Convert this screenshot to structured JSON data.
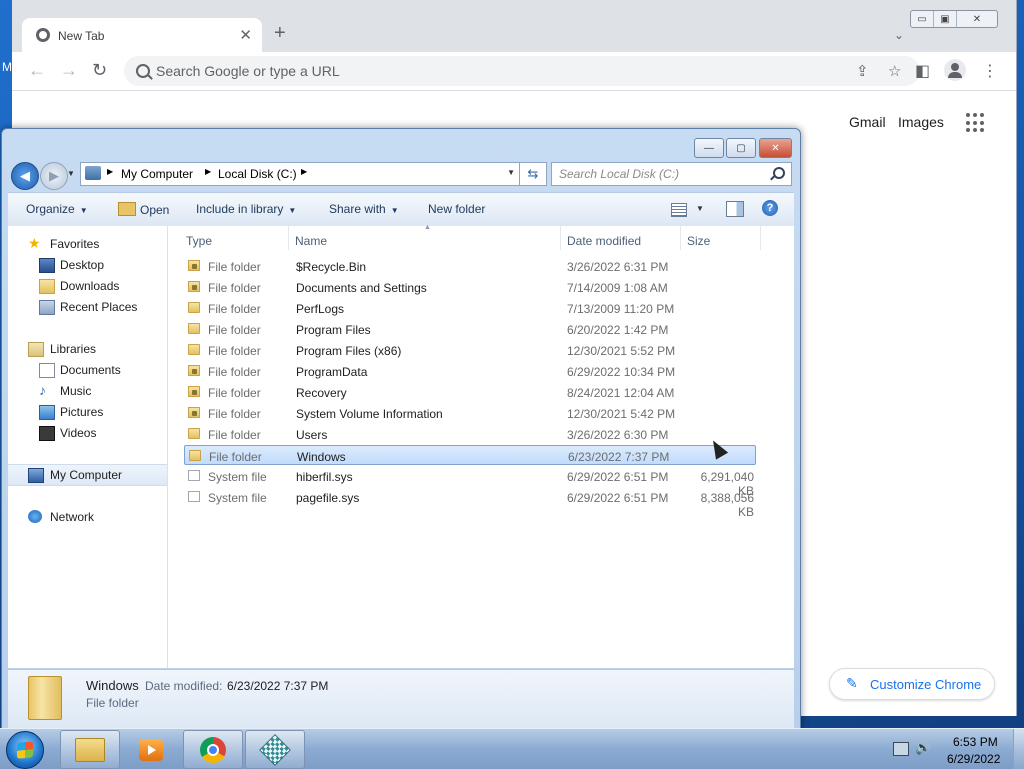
{
  "desktop": {
    "partial_label": "M"
  },
  "chrome": {
    "tab_title": "New Tab",
    "tab_close": "✕",
    "new_tab": "+",
    "tab_search": "⌄",
    "window": {
      "minimize": "▭",
      "maximize": "▣",
      "close": "✕"
    },
    "nav": {
      "back": "←",
      "forward": "→",
      "reload": "↻"
    },
    "omnibox_placeholder": "Search Google or type a URL",
    "share": "⇪",
    "bookmark": "☆",
    "sidepanel": "◧",
    "menu": "⋮",
    "links": {
      "gmail": "Gmail",
      "images": "Images"
    },
    "customize": {
      "icon": "✎",
      "label": "Customize Chrome"
    }
  },
  "explorer": {
    "window": {
      "minimize": "—",
      "maximize": "▢",
      "close": "✕"
    },
    "nav": {
      "back": "◀",
      "forward": "▶",
      "history": "▼"
    },
    "breadcrumb": [
      "My Computer",
      "Local Disk (C:)"
    ],
    "breadcrumb_sep": "▶",
    "address_dropdown": "▼",
    "refresh": "⇆",
    "search_placeholder": "Search Local Disk (C:)",
    "commands": {
      "organize": "Organize",
      "open": "Open",
      "include_in_library": "Include in library",
      "share_with": "Share with",
      "new_folder": "New folder"
    },
    "caret": "▼",
    "help": "?",
    "sidebar": {
      "favorites": "Favorites",
      "desktop": "Desktop",
      "downloads": "Downloads",
      "recent_places": "Recent Places",
      "libraries": "Libraries",
      "documents": "Documents",
      "music": "Music",
      "pictures": "Pictures",
      "videos": "Videos",
      "my_computer": "My Computer",
      "network": "Network"
    },
    "columns": {
      "type": "Type",
      "name": "Name",
      "date": "Date modified",
      "size": "Size",
      "sort": "▲"
    },
    "rows": [
      {
        "type": "File folder",
        "name": "$Recycle.Bin",
        "date": "3/26/2022 6:31 PM",
        "size": "",
        "icon": "locked-folder"
      },
      {
        "type": "File folder",
        "name": "Documents and Settings",
        "date": "7/14/2009 1:08 AM",
        "size": "",
        "icon": "locked-folder"
      },
      {
        "type": "File folder",
        "name": "PerfLogs",
        "date": "7/13/2009 11:20 PM",
        "size": "",
        "icon": "folder"
      },
      {
        "type": "File folder",
        "name": "Program Files",
        "date": "6/20/2022 1:42 PM",
        "size": "",
        "icon": "folder"
      },
      {
        "type": "File folder",
        "name": "Program Files (x86)",
        "date": "12/30/2021 5:52 PM",
        "size": "",
        "icon": "folder"
      },
      {
        "type": "File folder",
        "name": "ProgramData",
        "date": "6/29/2022 10:34 PM",
        "size": "",
        "icon": "locked-folder"
      },
      {
        "type": "File folder",
        "name": "Recovery",
        "date": "8/24/2021 12:04 AM",
        "size": "",
        "icon": "locked-folder"
      },
      {
        "type": "File folder",
        "name": "System Volume Information",
        "date": "12/30/2021 5:42 PM",
        "size": "",
        "icon": "locked-folder"
      },
      {
        "type": "File folder",
        "name": "Users",
        "date": "3/26/2022 6:30 PM",
        "size": "",
        "icon": "folder"
      },
      {
        "type": "File folder",
        "name": "Windows",
        "date": "6/23/2022 7:37 PM",
        "size": "",
        "icon": "folder",
        "selected": true
      },
      {
        "type": "System file",
        "name": "hiberfil.sys",
        "date": "6/29/2022 6:51 PM",
        "size": "6,291,040 KB",
        "icon": "system-file"
      },
      {
        "type": "System file",
        "name": "pagefile.sys",
        "date": "6/29/2022 6:51 PM",
        "size": "8,388,056 KB",
        "icon": "system-file"
      }
    ],
    "details": {
      "name": "Windows",
      "modified_label": "Date modified:",
      "modified_value": "6/23/2022 7:37 PM",
      "type": "File folder"
    }
  },
  "taskbar": {
    "clock_time": "6:53 PM",
    "clock_date": "6/29/2022",
    "volume": "🔊"
  }
}
